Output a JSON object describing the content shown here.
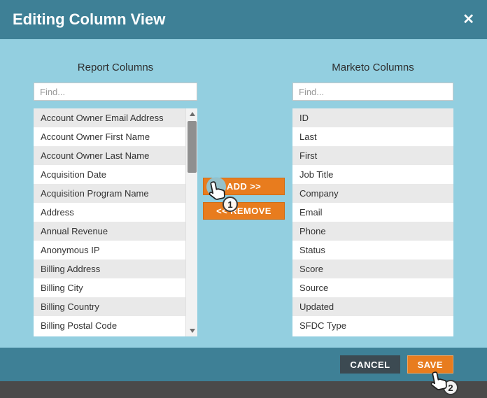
{
  "dialog": {
    "title": "Editing Column View",
    "close_icon": "✕"
  },
  "left_panel": {
    "heading": "Report Columns",
    "find_placeholder": "Find...",
    "items": [
      "Account Owner Email Address",
      "Account Owner First Name",
      "Account Owner Last Name",
      "Acquisition Date",
      "Acquisition Program Name",
      "Address",
      "Annual Revenue",
      "Anonymous IP",
      "Billing Address",
      "Billing City",
      "Billing Country",
      "Billing Postal Code"
    ]
  },
  "right_panel": {
    "heading": "Marketo Columns",
    "find_placeholder": "Find...",
    "items": [
      "ID",
      "Last",
      "First",
      "Job Title",
      "Company",
      "Email",
      "Phone",
      "Status",
      "Score",
      "Source",
      "Updated",
      "SFDC Type"
    ]
  },
  "transfer_buttons": {
    "add_label": "ADD >>",
    "remove_label": "<< REMOVE"
  },
  "footer": {
    "cancel_label": "CANCEL",
    "save_label": "SAVE"
  },
  "annotations": {
    "step1": "1",
    "step2": "2"
  },
  "colors": {
    "header_bg": "#3e8096",
    "body_bg": "#93cfe0",
    "accent_orange": "#e87c1e",
    "cancel_bg": "#3c4a52",
    "row_alt": "#e9e9e9"
  }
}
